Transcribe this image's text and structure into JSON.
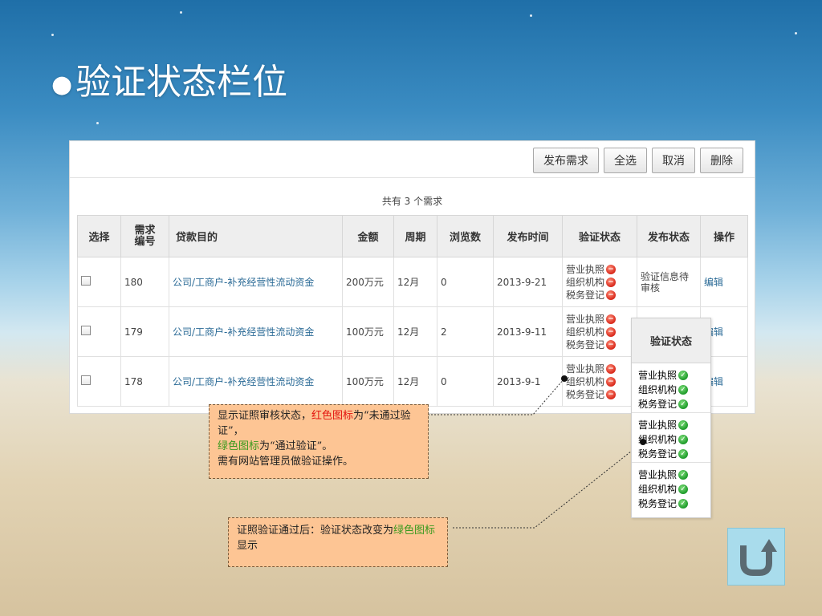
{
  "slide": {
    "bullet": "●",
    "title": "验证状态栏位"
  },
  "toolbar": {
    "publish": "发布需求",
    "select_all": "全选",
    "cancel": "取消",
    "delete": "删除"
  },
  "summary": "共有 3 个需求",
  "table": {
    "headers": {
      "select": "选择",
      "id": "需求\n编号",
      "purpose": "贷款目的",
      "amount": "金额",
      "period": "周期",
      "views": "浏览数",
      "published_time": "发布时间",
      "verify_status": "验证状态",
      "publish_status": "发布状态",
      "action": "操作"
    },
    "rows": [
      {
        "id": "180",
        "purpose": "公司/工商户-补充经营性流动资金",
        "amount": "200万元",
        "period": "12月",
        "views": "0",
        "date": "2013-9-21",
        "publish_status": "验证信息待审核",
        "action": "编辑"
      },
      {
        "id": "179",
        "purpose": "公司/工商户-补充经营性流动资金",
        "amount": "100万元",
        "period": "12月",
        "views": "2",
        "date": "2013-9-11",
        "publish_status": "",
        "action": "编辑"
      },
      {
        "id": "178",
        "purpose": "公司/工商户-补充经营性流动资金",
        "amount": "100万元",
        "period": "12月",
        "views": "0",
        "date": "2013-9-1",
        "publish_status": "",
        "action": "编辑"
      }
    ],
    "verify_items": [
      "营业执照",
      "组织机构",
      "税务登记"
    ]
  },
  "popup": {
    "header": "验证状态",
    "groups": [
      [
        "营业执照",
        "组织机构",
        "税务登记"
      ],
      [
        "营业执照",
        "组织机构",
        "税务登记"
      ],
      [
        "营业执照",
        "组织机构",
        "税务登记"
      ]
    ]
  },
  "callout1": {
    "part1": "显示证照审核状态，",
    "red": "红色图标",
    "part2": "为“未通过验证”，",
    "green": "绿色图标",
    "part3": "为“通过验证”。",
    "part4": "需有网站管理员做验证操作。"
  },
  "callout2": {
    "part1": "证照验证通过后：验证状态改变为",
    "green": "绿色图标",
    "part2": "显示"
  },
  "colors": {
    "red_icon": "#d8271a",
    "green_icon": "#1e9a2a",
    "link": "#2a6a96",
    "callout_bg": "#fdc594"
  },
  "icons": {
    "fail": "minus-circle-icon",
    "pass": "check-circle-icon",
    "back": "return-arrow-icon"
  }
}
